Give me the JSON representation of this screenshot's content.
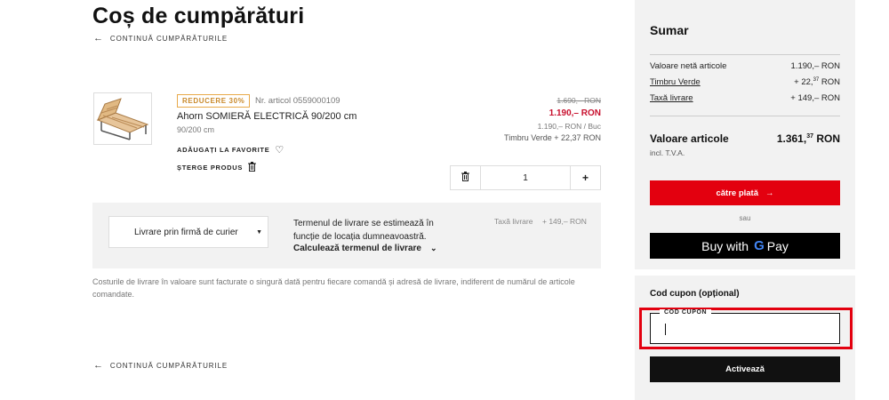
{
  "page": {
    "title": "Coș de cumpărături",
    "continue_link": "CONTINUĂ CUMPĂRĂTURILE"
  },
  "product": {
    "badge": "REDUCERE 30%",
    "article_no": "Nr. articol 0559000109",
    "name": "Ahorn SOMIERĂ ELECTRICĂ 90/200 cm",
    "size": "90/200 cm",
    "favorite_label": "ADĂUGAȚI LA FAVORITE",
    "delete_label": "ȘTERGE PRODUS",
    "price_old": "1.690,– RON",
    "price_new": "1.190,– RON",
    "price_unit": "1.190,– RON / Buc",
    "timbru": "Timbru Verde + 22,37 RON",
    "quantity": "1"
  },
  "delivery": {
    "method": "Livrare prin firmă de curier",
    "info": "Termenul de livrare se estimează în funcție de locația dumneavoastră.",
    "calc_label": "Calculează termenul de livrare",
    "tax_label": "Taxă livrare",
    "tax_value": "+ 149,– RON"
  },
  "note": "Costurile de livrare în valoare sunt facturate o singură dată pentru fiecare comandă și adresă de livrare, indiferent de numărul de articole comandate.",
  "summary": {
    "title": "Sumar",
    "rows": [
      {
        "label": "Valoare netă articole",
        "value": "1.190,– RON"
      },
      {
        "label": "Timbru Verde",
        "value_main": "+ 22,",
        "value_sup": "37",
        "value_tail": " RON"
      },
      {
        "label": "Taxă livrare",
        "value": "+ 149,– RON"
      }
    ],
    "total_label": "Valoare articole",
    "total_main": "1.361,",
    "total_sup": "37",
    "total_tail": " RON",
    "vat": "incl. T.V.A.",
    "pay_label": "către plată",
    "or_label": "sau",
    "gpay_buy": "Buy with",
    "gpay_g": "G",
    "gpay_pay": "Pay"
  },
  "coupon": {
    "title": "Cod cupon (opțional)",
    "field_label": "COD CUPON",
    "value": "",
    "activate_label": "Activează"
  },
  "colors": {
    "accent": "#e3000f",
    "badge": "#e8a94a",
    "sale_price": "#c8102e",
    "panel_bg": "#f2f2f2"
  }
}
